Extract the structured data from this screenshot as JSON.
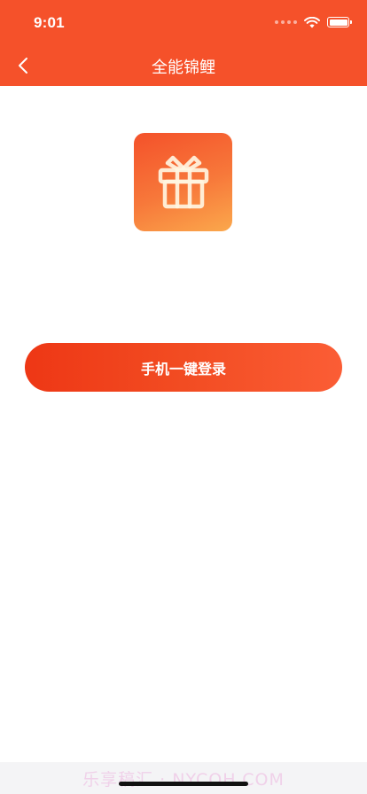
{
  "status_bar": {
    "time": "9:01",
    "icons": [
      "signal-dots-icon",
      "wifi-icon",
      "battery-icon"
    ]
  },
  "nav": {
    "back_icon": "chevron-left-icon",
    "title": "全能锦鲤"
  },
  "app_icon": {
    "icon": "gift-icon"
  },
  "login": {
    "label": "手机一键登录"
  },
  "footer": {
    "watermark": "乐享稿汇 · NYCOH.COM"
  },
  "colors": {
    "primary": "#f5512a",
    "button_start": "#ee3715",
    "button_end": "#fb5d35",
    "icon_gradient_end": "#fba84c"
  }
}
